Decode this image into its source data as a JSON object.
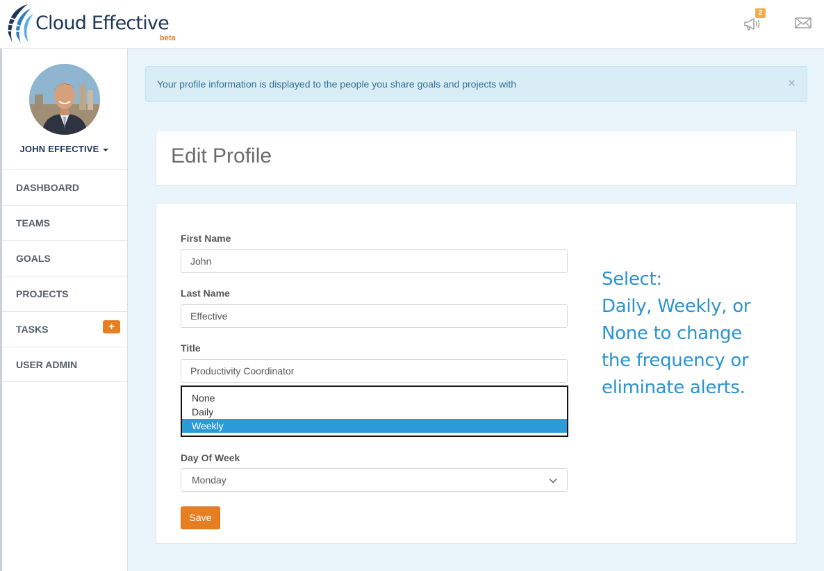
{
  "header": {
    "logo_text": "Cloud Effective",
    "logo_beta": "beta",
    "notifications_badge": "2",
    "icons": [
      "megaphone-icon",
      "mail-icon"
    ]
  },
  "sidebar": {
    "user_name": "JOHN EFFECTIVE",
    "items": [
      {
        "label": "DASHBOARD"
      },
      {
        "label": "TEAMS"
      },
      {
        "label": "GOALS"
      },
      {
        "label": "PROJECTS"
      },
      {
        "label": "TASKS",
        "action_icon": "plus-icon"
      },
      {
        "label": "USER ADMIN"
      }
    ]
  },
  "alert": {
    "message": "Your profile information is displayed to the people you share goals and projects with",
    "close": "×"
  },
  "page": {
    "title": "Edit Profile"
  },
  "form": {
    "first_name": {
      "label": "First Name",
      "value": "John"
    },
    "last_name": {
      "label": "Last Name",
      "value": "Effective"
    },
    "title": {
      "label": "Title",
      "value": "Productivity Coordinator"
    },
    "frequency": {
      "options": [
        "None",
        "Daily",
        "Weekly"
      ],
      "selected": "Weekly"
    },
    "day_of_week": {
      "label": "Day Of Week",
      "value": "Monday"
    },
    "save_label": "Save"
  },
  "annotation": {
    "lines": [
      "Select:",
      "Daily, Weekly, or",
      "None to change",
      "the frequency or",
      "eliminate alerts."
    ]
  },
  "colors": {
    "accent_orange": "#e67e22",
    "selection_blue": "#2b9bd8",
    "annotation_blue": "#2a93cf",
    "brand_navy": "#1d3557"
  }
}
